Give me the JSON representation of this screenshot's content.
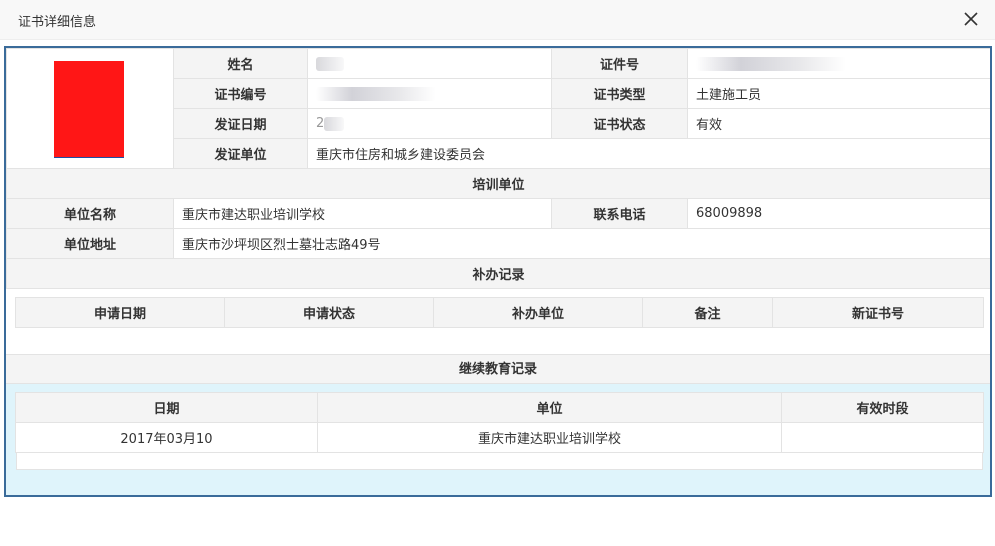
{
  "dialog": {
    "title": "证书详细信息"
  },
  "certificate": {
    "name_label": "姓名",
    "id_number_label": "证件号",
    "cert_number_label": "证书编号",
    "cert_type_label": "证书类型",
    "cert_type_value": "土建施工员",
    "issue_date_label": "发证日期",
    "issue_date_value_partial": "2",
    "cert_status_label": "证书状态",
    "cert_status_value": "有效",
    "issuer_label": "发证单位",
    "issuer_value": "重庆市住房和城乡建设委员会"
  },
  "training": {
    "section_title": "培训单位",
    "unit_name_label": "单位名称",
    "unit_name_value": "重庆市建达职业培训学校",
    "phone_label": "联系电话",
    "phone_value": "68009898",
    "address_label": "单位地址",
    "address_value": "重庆市沙坪坝区烈士墓壮志路49号"
  },
  "reissue": {
    "section_title": "补办记录",
    "columns": [
      "申请日期",
      "申请状态",
      "补办单位",
      "备注",
      "新证书号"
    ]
  },
  "education": {
    "section_title": "继续教育记录",
    "columns": [
      "日期",
      "单位",
      "有效时段"
    ],
    "rows": [
      {
        "date": "2017年03月10",
        "unit": "重庆市建达职业培训学校",
        "period": ""
      }
    ]
  }
}
